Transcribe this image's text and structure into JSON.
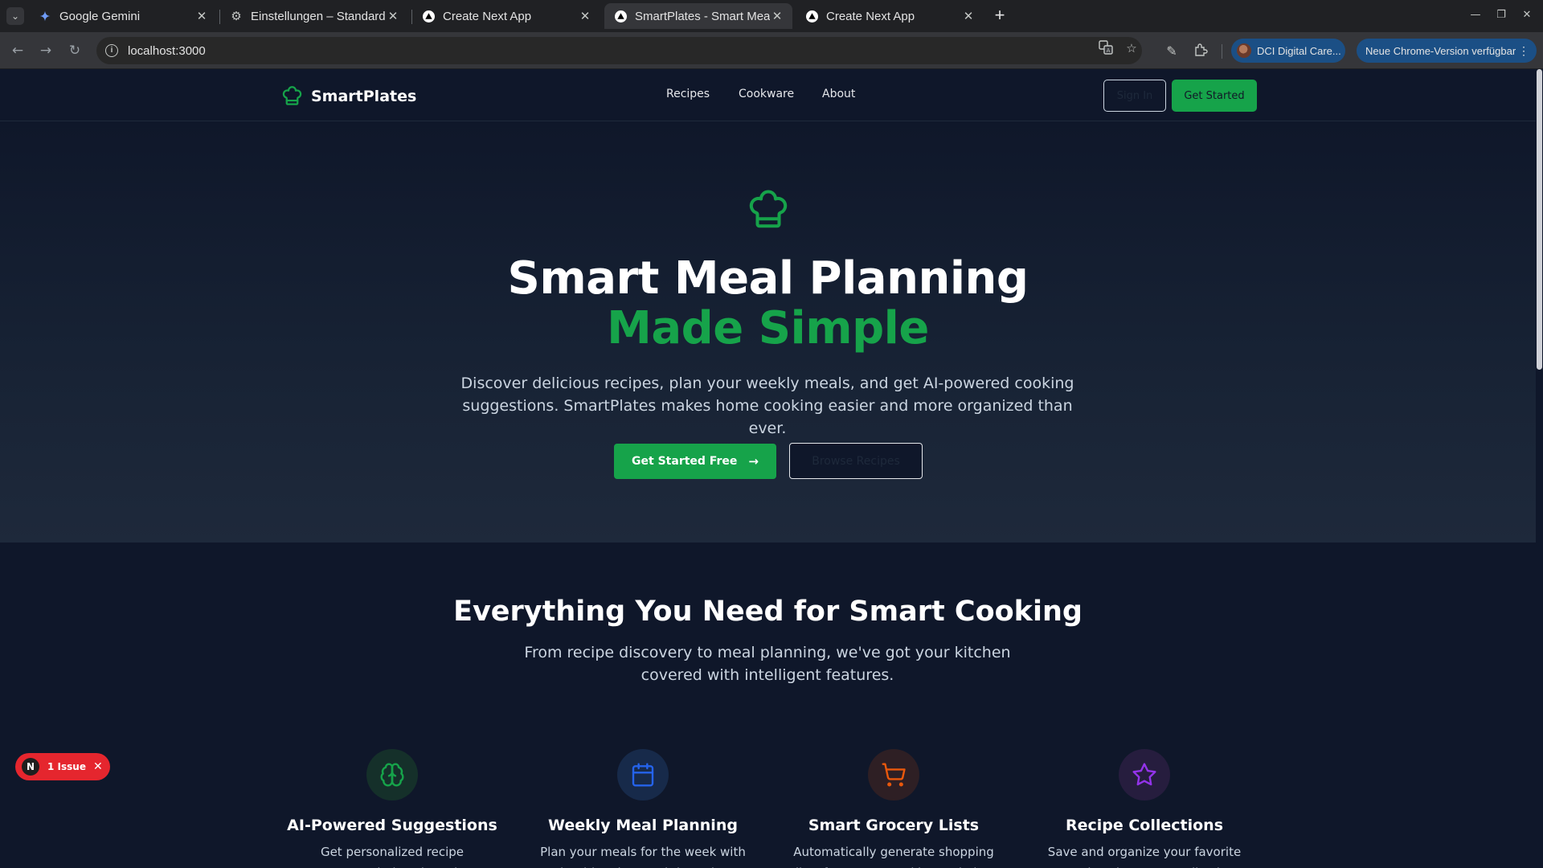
{
  "browser": {
    "tabs": [
      {
        "title": "Google Gemini",
        "icon": "gemini-sparkle-icon",
        "active": false
      },
      {
        "title": "Einstellungen – Standardbrowser",
        "icon": "gear-icon",
        "active": false
      },
      {
        "title": "Create Next App",
        "icon": "nextjs-triangle-icon",
        "active": false
      },
      {
        "title": "SmartPlates - Smart Meal Planning",
        "icon": "nextjs-triangle-icon",
        "active": true
      },
      {
        "title": "Create Next App",
        "icon": "nextjs-triangle-icon",
        "active": false
      }
    ],
    "new_tab": "+",
    "url": "localhost:3000",
    "profile_label": "DCI Digital Care...",
    "update_label": "Neue Chrome-Version verfügbar"
  },
  "site": {
    "brand": "SmartPlates",
    "nav": [
      "Recipes",
      "Cookware",
      "About"
    ],
    "signin_label": "Sign In",
    "getstarted_label": "Get Started",
    "accent_color": "#16a34a"
  },
  "hero": {
    "title_line1": "Smart Meal Planning",
    "title_line2": "Made Simple",
    "subtitle": "Discover delicious recipes, plan your weekly meals, and get AI-powered cooking suggestions. SmartPlates makes home cooking easier and more organized than ever.",
    "primary_cta": "Get Started Free",
    "secondary_cta": "Browse Recipes"
  },
  "features": {
    "title": "Everything You Need for Smart Cooking",
    "subtitle": "From recipe discovery to meal planning, we've got your kitchen covered with intelligent features.",
    "cards": [
      {
        "title": "AI-Powered Suggestions",
        "desc": "Get personalized recipe recommendations based on",
        "icon": "brain-icon",
        "color": "#16a34a"
      },
      {
        "title": "Weekly Meal Planning",
        "desc": "Plan your meals for the week with our intuitive drag-and-drop planner",
        "icon": "calendar-icon",
        "color": "#2563eb"
      },
      {
        "title": "Smart Grocery Lists",
        "desc": "Automatically generate shopping lists from your weekly meal plan",
        "icon": "shopping-cart-icon",
        "color": "#ea580c"
      },
      {
        "title": "Recipe Collections",
        "desc": "Save and organize your favorite recipes into personalized collections",
        "icon": "star-icon",
        "color": "#9333ea"
      }
    ]
  },
  "devtools": {
    "badge_letter": "N",
    "issues_label": "1 Issue",
    "dismiss": "✕"
  }
}
